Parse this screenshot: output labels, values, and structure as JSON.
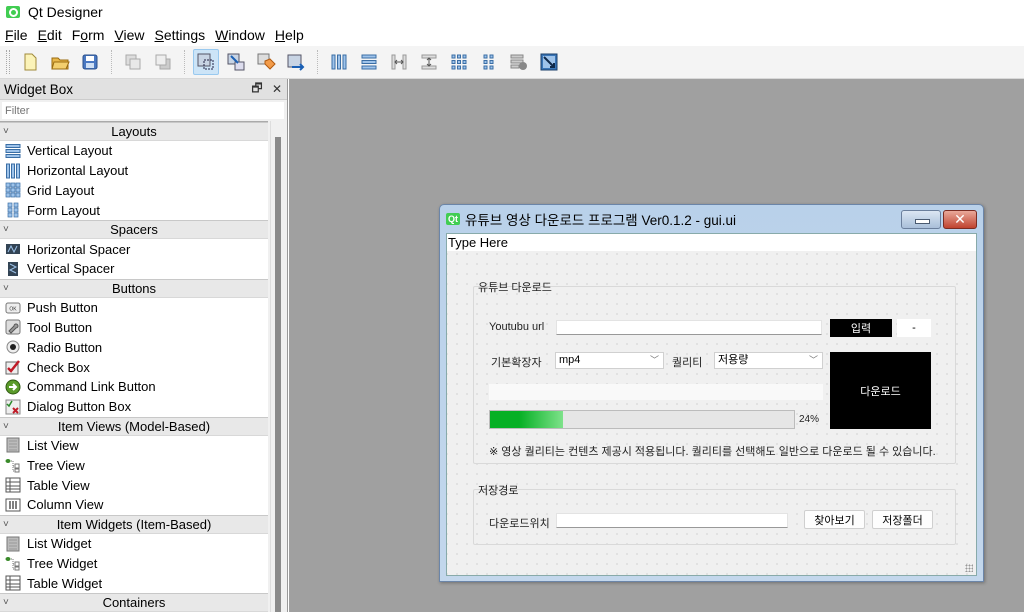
{
  "app": {
    "title": "Qt Designer"
  },
  "menubar": {
    "items": [
      {
        "label": "File",
        "mnemonic": "F",
        "rest": "ile"
      },
      {
        "label": "Edit",
        "mnemonic": "E",
        "rest": "dit"
      },
      {
        "label": "Form",
        "pre": "F",
        "mnemonic": "o",
        "rest": "rm"
      },
      {
        "label": "View",
        "mnemonic": "V",
        "rest": "iew"
      },
      {
        "label": "Settings",
        "mnemonic": "S",
        "rest": "ettings"
      },
      {
        "label": "Window",
        "mnemonic": "W",
        "rest": "indow"
      },
      {
        "label": "Help",
        "mnemonic": "H",
        "rest": "elp"
      }
    ]
  },
  "toolbar": {
    "buttons": [
      {
        "icon": "new-file-icon"
      },
      {
        "icon": "open-folder-icon"
      },
      {
        "icon": "save-icon"
      },
      {
        "icon": "send-to-back-icon"
      },
      {
        "icon": "bring-to-front-icon"
      },
      {
        "icon": "edit-widgets-icon",
        "active": true
      },
      {
        "icon": "edit-signals-slots-icon"
      },
      {
        "icon": "edit-buddies-icon"
      },
      {
        "icon": "edit-tab-order-icon"
      },
      {
        "icon": "layout-horizontal-icon"
      },
      {
        "icon": "layout-vertical-icon"
      },
      {
        "icon": "layout-horizontal-splitter-icon"
      },
      {
        "icon": "layout-vertical-splitter-icon"
      },
      {
        "icon": "layout-grid-icon"
      },
      {
        "icon": "layout-form-icon"
      },
      {
        "icon": "break-layout-icon"
      },
      {
        "icon": "adjust-size-icon"
      }
    ]
  },
  "widget_box": {
    "title": "Widget Box",
    "filter_placeholder": "Filter",
    "categories": [
      {
        "name": "Layouts",
        "items": [
          "Vertical Layout",
          "Horizontal Layout",
          "Grid Layout",
          "Form Layout"
        ]
      },
      {
        "name": "Spacers",
        "items": [
          "Horizontal Spacer",
          "Vertical Spacer"
        ]
      },
      {
        "name": "Buttons",
        "items": [
          "Push Button",
          "Tool Button",
          "Radio Button",
          "Check Box",
          "Command Link Button",
          "Dialog Button Box"
        ]
      },
      {
        "name": "Item Views (Model-Based)",
        "items": [
          "List View",
          "Tree View",
          "Table View",
          "Column View"
        ]
      },
      {
        "name": "Item Widgets (Item-Based)",
        "items": [
          "List Widget",
          "Tree Widget",
          "Table Widget"
        ]
      },
      {
        "name": "Containers",
        "items": []
      }
    ]
  },
  "form_window": {
    "badge": "Qt",
    "caption": "유튜브 영상 다운로드 프로그램 Ver0.1.2 - gui.ui",
    "menubar_placeholder": "Type Here",
    "close_glyph": "✕",
    "group_download": {
      "title": "유튜브 다운로드",
      "url_label": "Youtubu url",
      "url_value": "",
      "input_button": "입력",
      "dash_button": "-",
      "ext_label": "기본확장자",
      "ext_value": "mp4",
      "quality_label": "퀄리티",
      "quality_value": "저용량",
      "download_button": "다운로드",
      "progress_value": 24,
      "progress_text": "24%",
      "note": "※ 영상 퀄리티는 컨텐츠 제공시 적용됩니다. 퀄리티를 선택해도 일반으로 다운로드 될 수 있습니다."
    },
    "group_save": {
      "title": "저장경로",
      "location_label": "다운로드위치",
      "location_value": "",
      "browse_button": "찾아보기",
      "save_folder_button": "저장폴더"
    }
  }
}
